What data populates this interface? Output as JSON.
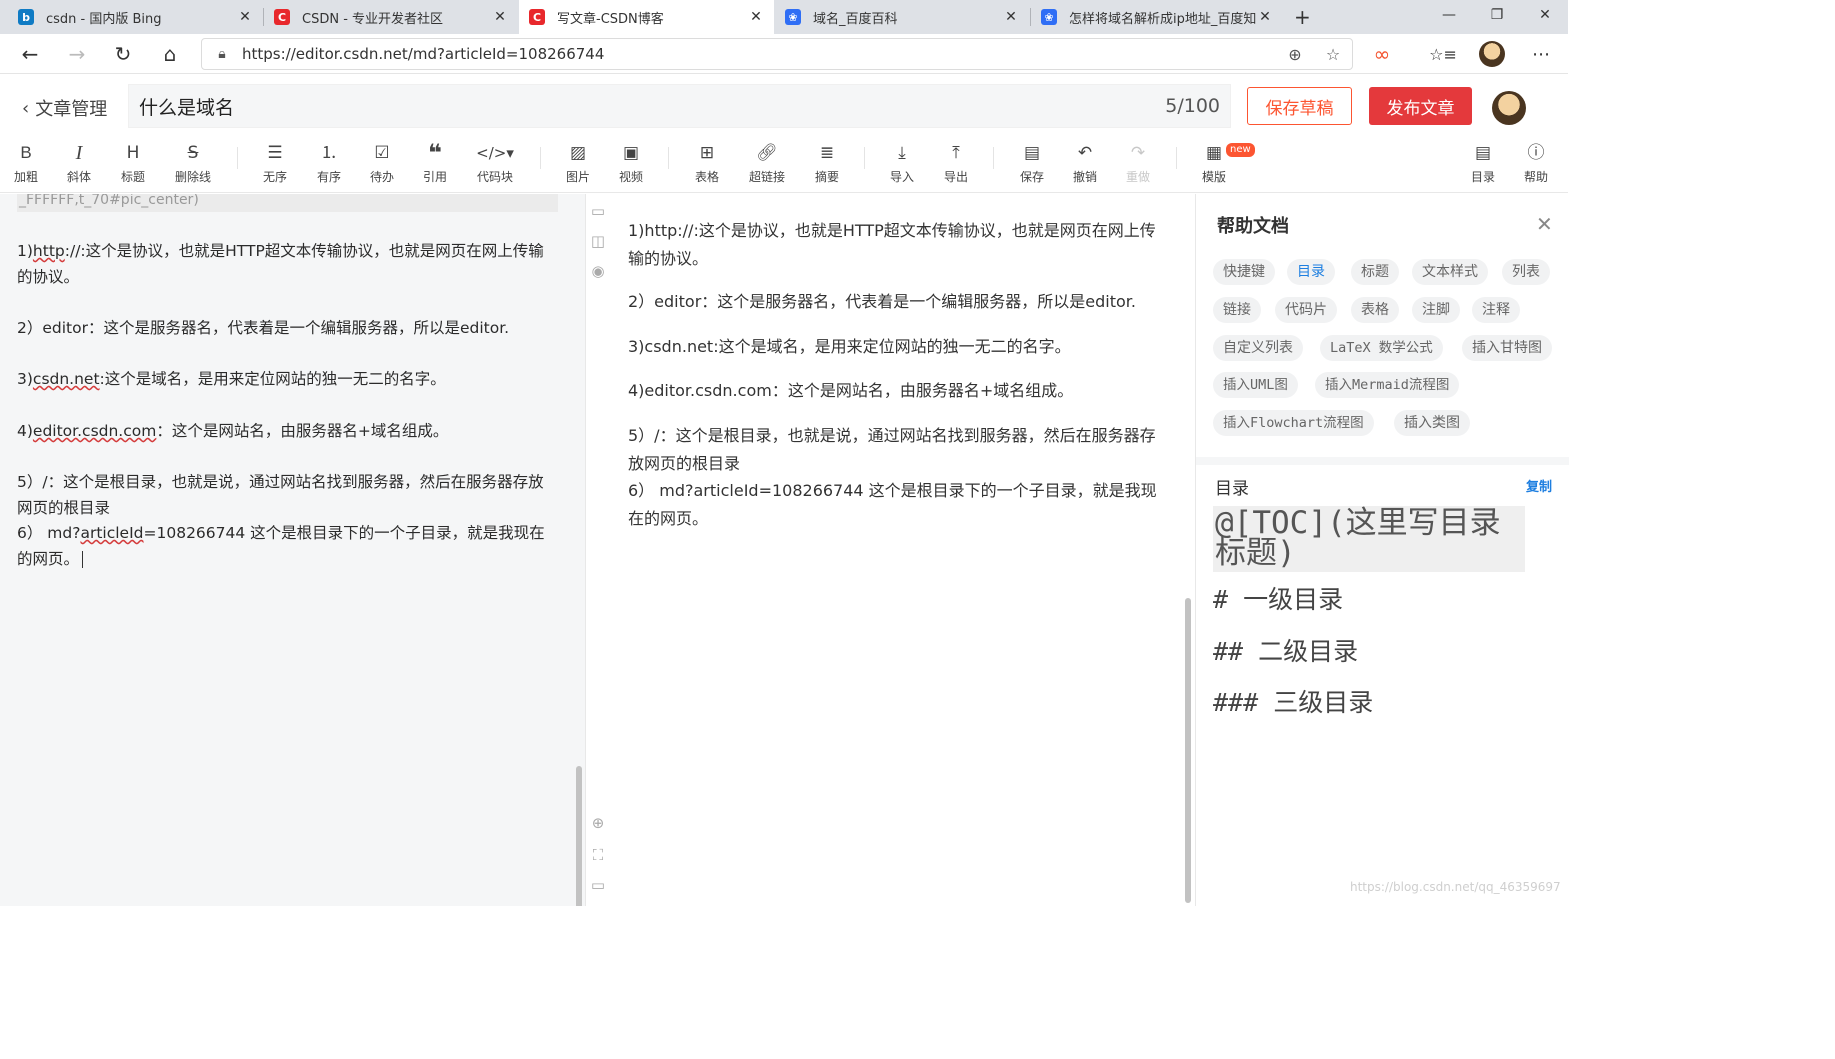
{
  "browser": {
    "tabs": [
      {
        "title": "csdn - 国内版 Bing",
        "icon": "bing-icon",
        "icon_color": "#0f7bc4",
        "active": false
      },
      {
        "title": "CSDN - 专业开发者社区",
        "icon": "csdn-icon",
        "icon_color": "#e8282c",
        "active": false
      },
      {
        "title": "写文章-CSDN博客",
        "icon": "csdn-icon",
        "icon_color": "#e8282c",
        "active": true
      },
      {
        "title": "域名_百度百科",
        "icon": "baidu-paw-icon",
        "icon_color": "#2f6ef5",
        "active": false
      },
      {
        "title": "怎样将域名解析成ip地址_百度知",
        "icon": "baidu-paw-icon",
        "icon_color": "#2f6ef5",
        "active": false
      }
    ],
    "new_tab": "+",
    "url": "https://editor.csdn.net/md?articleId=108266744"
  },
  "editor": {
    "back_label": "文章管理",
    "title": "什么是域名",
    "title_count": "5/100",
    "save_draft": "保存草稿",
    "publish": "发布文章",
    "accent": "#fc5531",
    "publish_color": "#e4393c"
  },
  "toolbar": {
    "bold": "加粗",
    "italic": "斜体",
    "heading": "标题",
    "strike": "删除线",
    "ul": "无序",
    "ol": "有序",
    "todo": "待办",
    "quote": "引用",
    "code": "代码块",
    "image": "图片",
    "video": "视频",
    "table": "表格",
    "link": "超链接",
    "summary": "摘要",
    "import": "导入",
    "export": "导出",
    "save": "保存",
    "undo": "撤销",
    "redo": "重做",
    "template": "模版",
    "template_badge": "new",
    "toc": "目录",
    "help": "帮助"
  },
  "source": {
    "cut_line": "_FFFFFF,t_70#pic_center)",
    "p1_pre": "1)",
    "p1_link": "http",
    "p1_rest": "://:这个是协议，也就是HTTP超文本传输协议，也就是网页在网上传输的协议。",
    "p2": "2）editor：这个是服务器名，代表着是一个编辑服务器，所以是editor.",
    "p3_pre": "3)",
    "p3_link": "csdn.net",
    "p3_rest": ":这个是域名，是用来定位网站的独一无二的名字。",
    "p4_pre": "4)",
    "p4_link": "editor.csdn.com",
    "p4_rest": "：这个是网站名，由服务器名+域名组成。",
    "p5": "5）/：这个是根目录，也就是说，通过网站名找到服务器，然后在服务器存放网页的根目录",
    "p6_pre": "6）  md?",
    "p6_link": "articleId",
    "p6_rest": "=108266744 这个是根目录下的一个子目录，就是我现在的网页。"
  },
  "preview": {
    "p1": "1)http://:这个是协议，也就是HTTP超文本传输协议，也就是网页在网上传输的协议。",
    "p2": "2）editor：这个是服务器名，代表着是一个编辑服务器，所以是editor.",
    "p3": "3)csdn.net:这个是域名，是用来定位网站的独一无二的名字。",
    "p4": "4)editor.csdn.com：这个是网站名，由服务器名+域名组成。",
    "p5": "5）/：这个是根目录，也就是说，通过网站名找到服务器，然后在服务器存放网页的根目录",
    "p6": "6）  md?articleId=108266744 这个是根目录下的一个子目录，就是我现在的网页。"
  },
  "help": {
    "title": "帮助文档",
    "chips": [
      "快捷键",
      "目录",
      "标题",
      "文本样式",
      "列表",
      "链接",
      "代码片",
      "表格",
      "注脚",
      "注释",
      "自定义列表",
      "LaTeX 数学公式",
      "插入甘特图",
      "插入UML图",
      "插入Mermaid流程图",
      "插入Flowchart流程图",
      "插入类图"
    ],
    "toc_title": "目录",
    "toc_copy": "复制",
    "toc_code": "@[TOC](这里写目录标题)",
    "h1": "#  一级目录",
    "h2": "##  二级目录",
    "h3": "###  三级目录"
  },
  "watermark": "https://blog.csdn.net/qq_46359697"
}
